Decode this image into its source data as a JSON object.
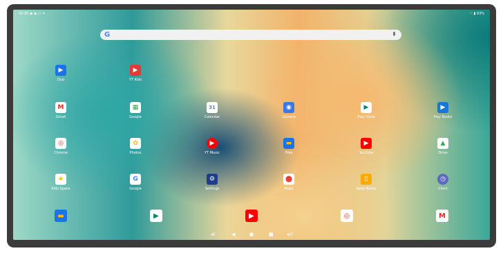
{
  "status_bar": {
    "time": "02:35 ◉ ◉ ▭ ✈",
    "right": "♡ ▮ 93%"
  },
  "search": {
    "g": "G"
  },
  "apps": [
    {
      "label": "Duo",
      "icon": "video-icon",
      "glyph": "▶",
      "color": "#1a73e8"
    },
    {
      "label": "YT Kids",
      "icon": "yt-kids-icon",
      "glyph": "▶",
      "color": "#e53935"
    },
    {
      "label": "Gmail",
      "icon": "gmail-icon",
      "glyph": "M",
      "color": "#ffffff"
    },
    {
      "label": "Google",
      "icon": "google-folder-icon",
      "glyph": "▦",
      "color": "#ffffff"
    },
    {
      "label": "Calendar",
      "icon": "calendar-icon",
      "glyph": "31",
      "color": "#4285f4"
    },
    {
      "label": "Camera",
      "icon": "camera-icon",
      "glyph": "◉",
      "color": "#3b78e7"
    },
    {
      "label": "Play Store",
      "icon": "play-store-icon",
      "glyph": "▶",
      "color": "#ffffff"
    },
    {
      "label": "Play Books",
      "icon": "play-books-icon",
      "glyph": "▶",
      "color": "#1976d2"
    },
    {
      "label": "Chrome",
      "icon": "chrome-icon",
      "glyph": "◎",
      "color": "#ffffff"
    },
    {
      "label": "Photos",
      "icon": "photos-icon",
      "glyph": "✿",
      "color": "#ffffff"
    },
    {
      "label": "YT Music",
      "icon": "yt-music-icon",
      "glyph": "▶",
      "color": "#ff0000"
    },
    {
      "label": "Files",
      "icon": "files-icon",
      "glyph": "▬",
      "color": "#1a73e8"
    },
    {
      "label": "YouTube",
      "icon": "youtube-icon",
      "glyph": "▶",
      "color": "#ff0000"
    },
    {
      "label": "Drive",
      "icon": "drive-icon",
      "glyph": "▲",
      "color": "#ffffff"
    },
    {
      "label": "Kids Space",
      "icon": "kids-space-icon",
      "glyph": "★",
      "color": "#ffffff"
    },
    {
      "label": "Google",
      "icon": "google-icon",
      "glyph": "G",
      "color": "#ffffff"
    },
    {
      "label": "Settings",
      "icon": "settings-icon",
      "glyph": "⚙",
      "color": "#1f3c88"
    },
    {
      "label": "Maps",
      "icon": "maps-icon",
      "glyph": "⬤",
      "color": "#ffffff"
    },
    {
      "label": "Keep Notes",
      "icon": "keep-notes-icon",
      "glyph": "▯",
      "color": "#f9ab00"
    },
    {
      "label": "Clock",
      "icon": "clock-icon",
      "glyph": "◷",
      "color": "#5c6bc0"
    }
  ],
  "dock": [
    {
      "icon": "files-icon",
      "glyph": "▬",
      "color": "#1a73e8"
    },
    {
      "icon": "play-store-icon",
      "glyph": "▶",
      "color": "#ffffff"
    },
    {
      "icon": "youtube-icon",
      "glyph": "▶",
      "color": "#ff0000"
    },
    {
      "icon": "chrome-icon",
      "glyph": "◎",
      "color": "#ffffff"
    },
    {
      "icon": "gmail-icon",
      "glyph": "M",
      "color": "#ffffff"
    }
  ],
  "nav": {
    "vol_down": "◂)",
    "back": "◀",
    "home": "●",
    "recents": "■",
    "vol_up": "◂))"
  }
}
